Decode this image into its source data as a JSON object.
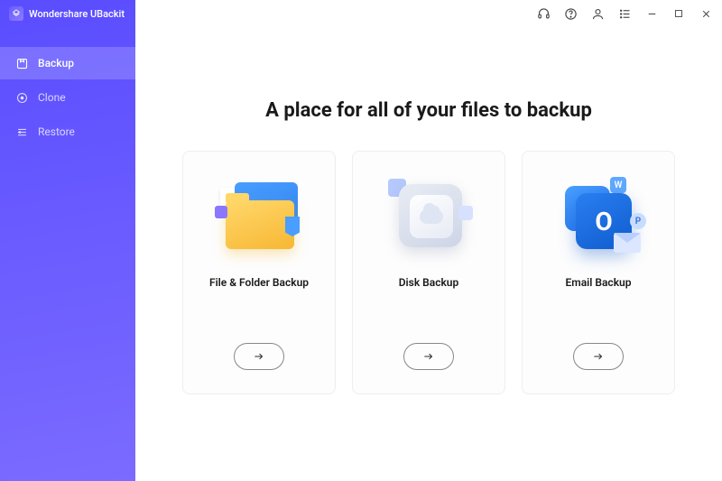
{
  "app": {
    "title": "Wondershare UBackit"
  },
  "sidebar": {
    "items": [
      {
        "label": "Backup",
        "icon": "backup-icon",
        "active": true
      },
      {
        "label": "Clone",
        "icon": "clone-icon",
        "active": false
      },
      {
        "label": "Restore",
        "icon": "restore-icon",
        "active": false
      }
    ]
  },
  "page": {
    "heading": "A place for all of your files to backup"
  },
  "cards": [
    {
      "title": "File & Folder Backup",
      "illustration": "folder"
    },
    {
      "title": "Disk Backup",
      "illustration": "disk"
    },
    {
      "title": "Email Backup",
      "illustration": "email"
    }
  ],
  "titlebar_icons": [
    "headset",
    "help",
    "user",
    "list",
    "minimize",
    "maximize",
    "close"
  ]
}
